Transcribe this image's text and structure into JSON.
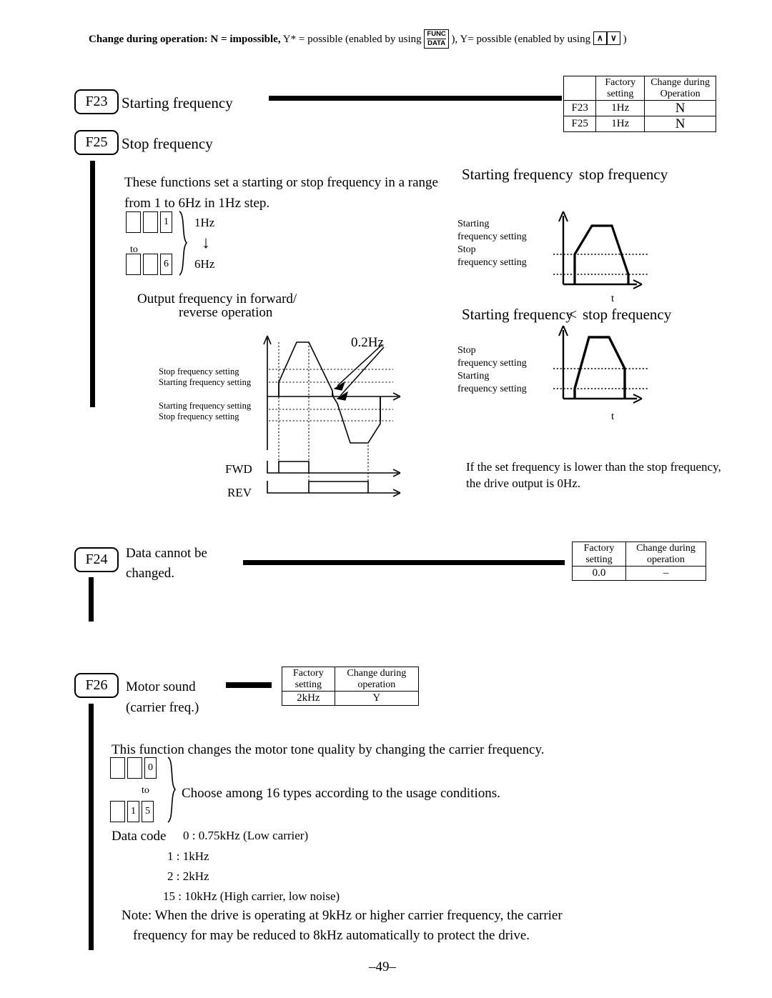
{
  "header": {
    "legend_bold": "Change during operation: N = impossible,",
    "legend_y_star": "Y* = possible (enabled by using",
    "func_key_top": "FUNC",
    "func_key_bottom": "DATA",
    "legend_mid": "), Y= possible (enabled by using",
    "up_key": "∧",
    "down_key": "∨",
    "legend_end": ")"
  },
  "f23": {
    "code": "F23",
    "title": "Starting frequency"
  },
  "f25": {
    "code": "F25",
    "title": "Stop frequency"
  },
  "table_f23_f25": {
    "col_blank": "",
    "col_factory": "Factory",
    "col_factory2": "setting",
    "col_change": "Change during",
    "col_change2": "Operation",
    "rows": [
      {
        "code": "F23",
        "factory": "1Hz",
        "change": "N"
      },
      {
        "code": "F25",
        "factory": "1Hz",
        "change": "N"
      }
    ]
  },
  "f23_body": {
    "line1": "These functions set a starting or stop frequency in a range",
    "line2": "from 1 to 6Hz in 1Hz step.",
    "digits_top": [
      "",
      "",
      "1"
    ],
    "digits_bottom": [
      "",
      "",
      "6"
    ],
    "to_label": "to",
    "hz_top": "1Hz",
    "hz_bottom": "6Hz",
    "arrow_glyph": "↓"
  },
  "fwd_rev_diagram": {
    "title_line1": "Output frequency in forward/",
    "title_line2": "reverse operation",
    "annotation": "0.2Hz",
    "label_top_1": "Stop frequency setting",
    "label_top_2": "Starting frequency setting",
    "label_bot_1": "Starting frequency setting",
    "label_bot_2": "Stop frequency setting",
    "fwd": "FWD",
    "rev": "REV"
  },
  "graph_ge": {
    "heading_left": "Starting frequency",
    "heading_op": "",
    "heading_right": "stop frequency",
    "label_1": "Starting",
    "label_2": " frequency setting",
    "label_3": "Stop",
    "label_4": "frequency setting",
    "axis_t": "t"
  },
  "graph_lt": {
    "heading_left": "Starting frequency",
    "heading_op": "<",
    "heading_right": "stop frequency",
    "label_1": "Stop",
    "label_2": "frequency setting",
    "label_3": "Starting",
    "label_4": "frequency setting",
    "axis_t": "t"
  },
  "note_right": {
    "line1": "If the set frequency is lower than the stop frequency,",
    "line2": "the drive output is 0Hz."
  },
  "f24": {
    "code": "F24",
    "title_line1": "Data cannot be",
    "title_line2": "changed."
  },
  "table_f24": {
    "col_factory": "Factory",
    "col_factory2": "setting",
    "col_change": "Change during",
    "col_change2": "operation",
    "factory_value": "0.0",
    "change_value": "–"
  },
  "f26": {
    "code": "F26",
    "title_line1": "Motor sound",
    "title_line2": "(carrier freq.)"
  },
  "table_f26": {
    "col_factory": "Factory",
    "col_factory2": "setting",
    "col_change": "Change during",
    "col_change2": "operation",
    "factory_value": "2kHz",
    "change_value": "Y"
  },
  "f26_body": {
    "intro": "This function changes the motor tone quality by changing the carrier frequency.",
    "digits_top": [
      "",
      "",
      "0"
    ],
    "digits_bottom": [
      "",
      "1",
      "5"
    ],
    "to_label": "to",
    "choose": "Choose among 16 types according to the usage conditions.",
    "data_code_label": "Data code",
    "codes": [
      "0 : 0.75kHz (Low carrier)",
      "1 : 1kHz",
      "2 : 2kHz",
      "15 : 10kHz (High carrier, low noise)"
    ],
    "note_line1": "Note: When the drive is operating at 9kHz or higher carrier frequency, the carrier",
    "note_line2": "frequency for may be reduced to 8kHz automatically to protect the drive."
  },
  "footer": {
    "page_number": "–49–"
  }
}
